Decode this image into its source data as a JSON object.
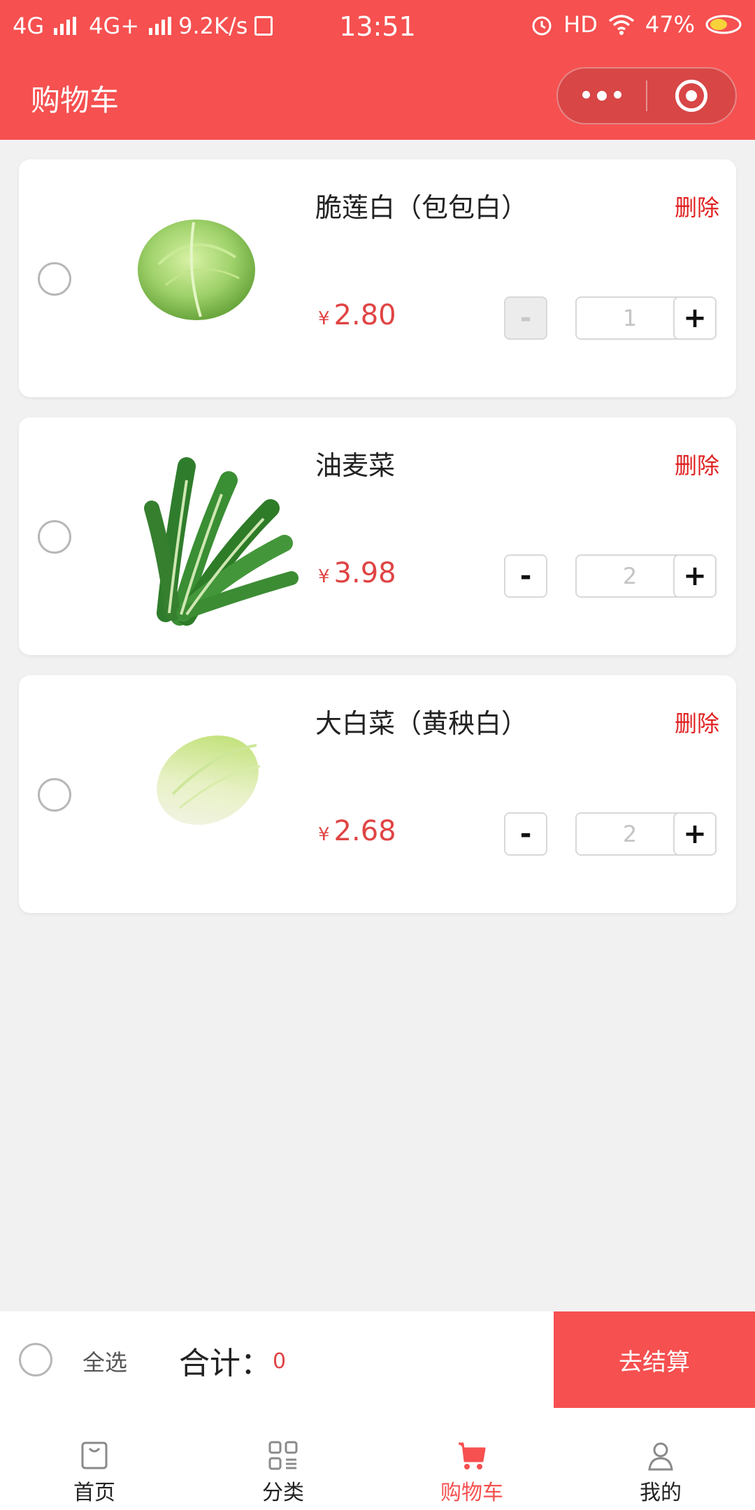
{
  "status_bar": {
    "network1": "4G",
    "network2": "4G+",
    "speed": "9.2K/s",
    "time": "13:51",
    "hd": "HD",
    "battery": "47%"
  },
  "nav": {
    "title": "购物车"
  },
  "cart": {
    "items": [
      {
        "name": "脆莲白（包包白）",
        "delete": "删除",
        "currency": "¥",
        "price": "2.80",
        "qty": "1",
        "minus": "-",
        "plus": "+",
        "minus_disabled": true
      },
      {
        "name": "油麦菜",
        "delete": "删除",
        "currency": "¥",
        "price": "3.98",
        "qty": "2",
        "minus": "-",
        "plus": "+",
        "minus_disabled": false
      },
      {
        "name": "大白菜（黄秧白）",
        "delete": "删除",
        "currency": "¥",
        "price": "2.68",
        "qty": "2",
        "minus": "-",
        "plus": "+",
        "minus_disabled": false
      }
    ]
  },
  "checkout": {
    "select_all": "全选",
    "total_label": "合计：",
    "total_value": "0",
    "pay_button": "去结算"
  },
  "tabbar": {
    "tabs": [
      {
        "label": "首页",
        "icon": "home-bag-icon"
      },
      {
        "label": "分类",
        "icon": "category-grid-icon"
      },
      {
        "label": "购物车",
        "icon": "cart-icon",
        "active": true
      },
      {
        "label": "我的",
        "icon": "person-icon"
      }
    ]
  },
  "colors": {
    "brand": "#f65050",
    "price": "#e04444",
    "delete": "#e02020"
  }
}
